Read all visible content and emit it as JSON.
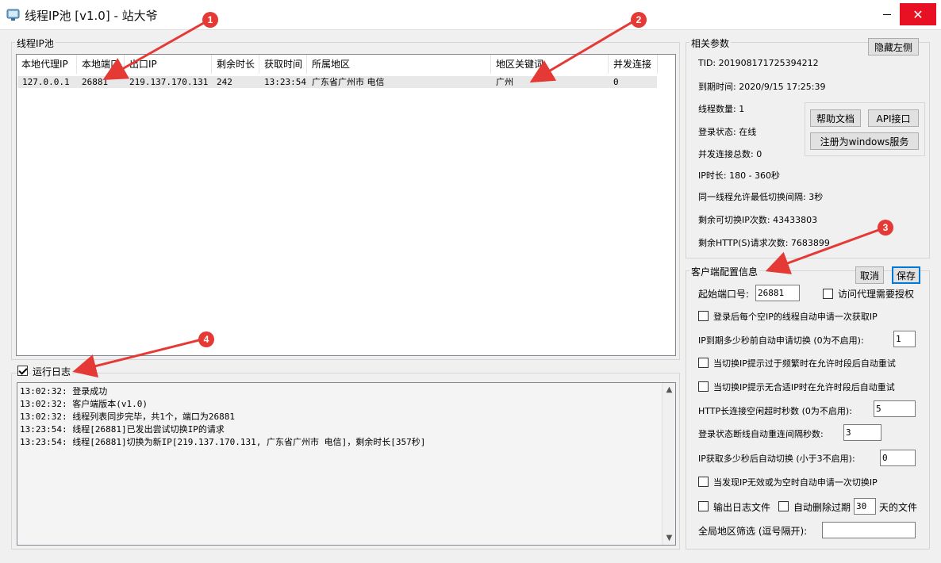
{
  "window": {
    "title": "线程IP池 [v1.0] - 站大爷",
    "minimize_label": "",
    "close_label": "✕"
  },
  "ip_pool": {
    "group_title": "线程IP池",
    "columns": [
      "本地代理IP",
      "本地端口",
      "出口IP",
      "剩余时长",
      "获取时间",
      "所属地区",
      "地区关键词",
      "并发连接"
    ],
    "rows": [
      [
        "127.0.0.1",
        "26881",
        "219.137.170.131",
        "242",
        "13:23:54",
        "广东省广州市 电信",
        "广州",
        "0"
      ]
    ]
  },
  "log": {
    "checkbox_label": "运行日志",
    "checked": true,
    "lines": [
      "13:02:32: 登录成功",
      "13:02:32: 客户端版本(v1.0)",
      "13:02:32: 线程列表同步完毕，共1个，端口为26881",
      "13:23:54: 线程[26881]已发出尝试切换IP的请求",
      "13:23:54: 线程[26881]切换为新IP[219.137.170.131, 广东省广州市 电信]，剩余时长[357秒]"
    ]
  },
  "params": {
    "group_title": "相关参数",
    "hide_left_button": "隐藏左侧",
    "tid": "TID: 201908171725394212",
    "expire": "到期时间: 2020/9/15 17:25:39",
    "thread_count": "线程数量: 1",
    "login_status": "登录状态: 在线",
    "concurrent_total": "并发连接总数: 0",
    "ip_duration": "IP时长: 180 - 360秒",
    "min_interval": "同一线程允许最低切换间隔: 3秒",
    "remaining_switches": "剩余可切换IP次数: 43433803",
    "remaining_http": "剩余HTTP(S)请求次数: 7683899",
    "help_button": "帮助文档",
    "api_button": "API接口",
    "register_service_button": "注册为windows服务"
  },
  "config": {
    "group_title": "客户端配置信息",
    "cancel_button": "取消",
    "save_button": "保存",
    "start_port_label": "起始端口号:",
    "start_port_value": "26881",
    "auth_label": "访问代理需要授权",
    "auto_fetch_label": "登录后每个空IP的线程自动申请一次获取IP",
    "expire_switch_label": "IP到期多少秒前自动申请切换 (0为不启用):",
    "expire_switch_value": "1",
    "retry_frequent_label": "当切换IP提示过于频繁时在允许时段后自动重试",
    "retry_noip_label": "当切换IP提示无合适IP时在允许时段后自动重试",
    "http_idle_label": "HTTP长连接空闲超时秒数 (0为不启用):",
    "http_idle_value": "5",
    "reconnect_label": "登录状态断线自动重连间隔秒数:",
    "reconnect_value": "3",
    "auto_switch_label": "IP获取多少秒后自动切换 (小于3不启用):",
    "auto_switch_value": "0",
    "invalid_ip_label": "当发现IP无效或为空时自动申请一次切换IP",
    "log_file_label": "输出日志文件",
    "auto_delete_label": "自动删除过期",
    "auto_delete_days": "30",
    "days_suffix": "天的文件",
    "region_filter_label": "全局地区筛选 (逗号隔开):",
    "region_filter_value": ""
  },
  "markers": [
    "1",
    "2",
    "3",
    "4"
  ],
  "colors": {
    "marker": "#e53935",
    "close_button": "#e81123",
    "primary_border": "#0078d7"
  }
}
